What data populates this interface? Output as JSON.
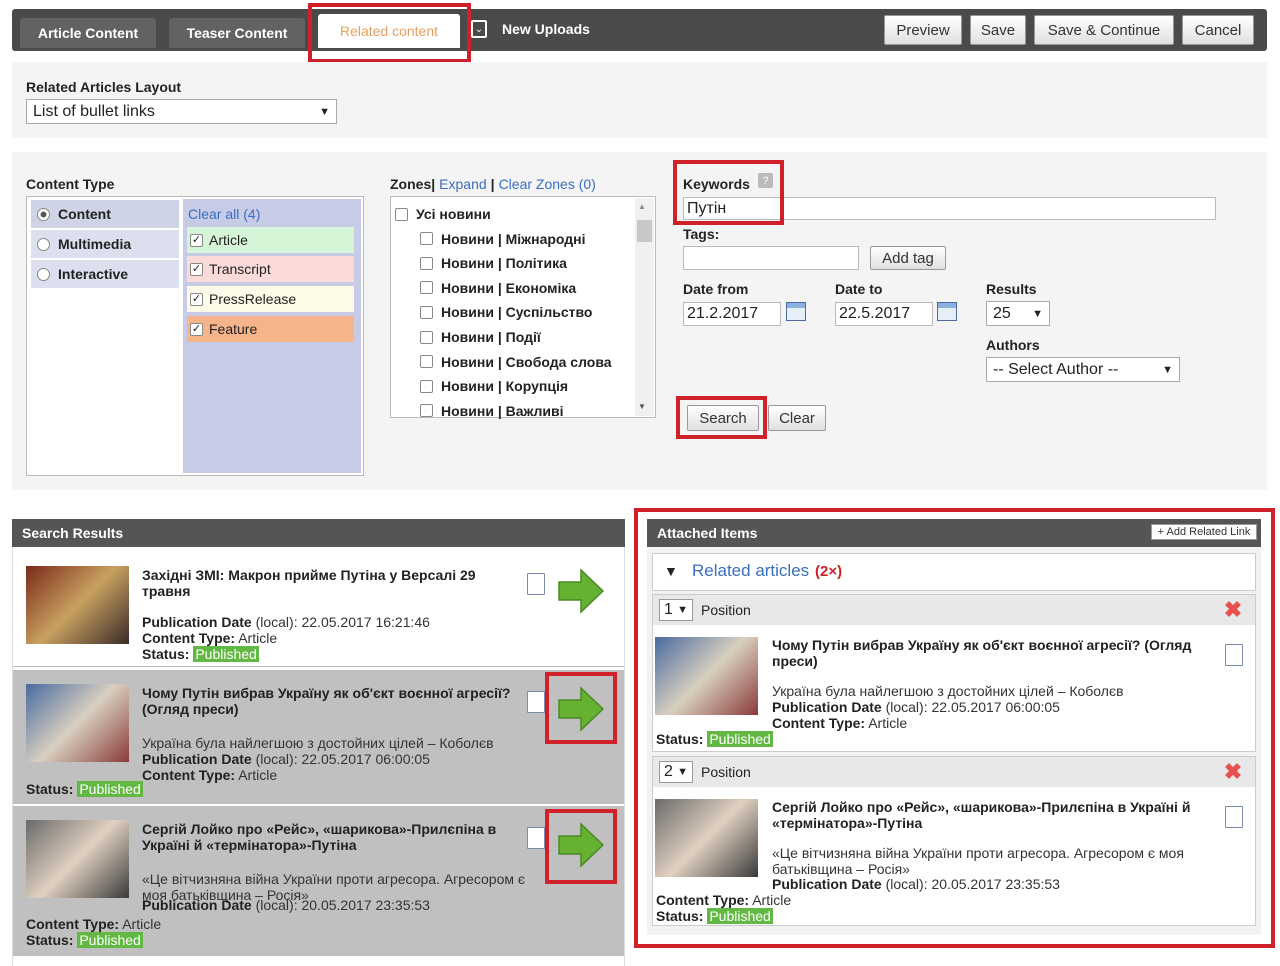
{
  "tabs": {
    "article": "Article Content",
    "teaser": "Teaser Content",
    "related": "Related content",
    "uploads": "New Uploads"
  },
  "toolbar": {
    "preview": "Preview",
    "save": "Save",
    "save_continue": "Save & Continue",
    "cancel": "Cancel"
  },
  "layout": {
    "label": "Related Articles Layout",
    "value": "List of bullet links"
  },
  "content_type": {
    "label": "Content Type",
    "types": [
      "Content",
      "Multimedia",
      "Interactive"
    ],
    "clear_all": "Clear all (4)",
    "subtypes": [
      {
        "label": "Article",
        "color": "#d6f5d6"
      },
      {
        "label": "Transcript",
        "color": "#fbdada"
      },
      {
        "label": "PressRelease",
        "color": "#fdfbe8"
      },
      {
        "label": "Feature",
        "color": "#f6b48a"
      }
    ]
  },
  "zones": {
    "label": "Zones|",
    "expand": "Expand",
    "sep": "|",
    "clear": "Clear Zones (0)",
    "items": [
      "Усі новини",
      "Новини | Міжнародні",
      "Новини | Політика",
      "Новини | Економіка",
      "Новини | Суспільство",
      "Новини | Події",
      "Новини | Свобода слова",
      "Новини | Корупція",
      "Новини | Важливі"
    ]
  },
  "filters": {
    "keywords_label": "Keywords",
    "keywords_value": "Путін",
    "tags_label": "Tags:",
    "add_tag": "Add tag",
    "date_from_label": "Date from",
    "date_from": "21.2.2017",
    "date_to_label": "Date to",
    "date_to": "22.5.2017",
    "results_label": "Results",
    "results_value": "25",
    "authors_label": "Authors",
    "authors_value": "-- Select Author --",
    "search": "Search",
    "clear": "Clear"
  },
  "search_results": {
    "header": "Search Results",
    "items": [
      {
        "title": "Західні ЗМІ: Макрон прийме Путіна у Версалі 29 травня",
        "summary": "",
        "pub_label": "Publication Date",
        "pub_local": "(local):",
        "pub_value": "22.05.2017 16:21:46",
        "type_label": "Content Type:",
        "type_value": "Article",
        "status_label": "Status:",
        "status_value": "Published"
      },
      {
        "title": "Чому Путін вибрав Україну як об'єкт воєнної агресії? (Огляд преси)",
        "summary": "Україна була найлегшою з достойних цілей – Коболєв",
        "pub_label": "Publication Date",
        "pub_local": "(local):",
        "pub_value": "22.05.2017 06:00:05",
        "type_label": "Content Type:",
        "type_value": "Article",
        "status_label": "Status:",
        "status_value": "Published"
      },
      {
        "title": "Сергій Лойко про «Рейс», «шарикова»-Прилєпіна в Україні й «термінатора»-Путіна",
        "summary": "«Це вітчизняна війна України проти агресора. Агресором є моя батьківщина – Росія»",
        "pub_label": "Publication Date",
        "pub_local": "(local):",
        "pub_value": "20.05.2017 23:35:53",
        "type_label": "Content Type:",
        "type_value": "Article",
        "status_label": "Status:",
        "status_value": "Published"
      }
    ]
  },
  "attached": {
    "header": "Attached Items",
    "add_link": "+ Add Related Link",
    "group_label": "Related articles",
    "group_count": "(2×)",
    "position_label": "Position",
    "items": [
      {
        "position": "1",
        "title": "Чому Путін вибрав Україну як об'єкт воєнної агресії? (Огляд преси)",
        "summary": "Україна була найлегшою з достойних цілей – Коболєв",
        "pub_label": "Publication Date",
        "pub_local": "(local):",
        "pub_value": "22.05.2017 06:00:05",
        "type_label": "Content Type:",
        "type_value": "Article",
        "status_label": "Status:",
        "status_value": "Published"
      },
      {
        "position": "2",
        "title": "Сергій Лойко про «Рейс», «шарикова»-Прилєпіна в Україні й «термінатора»-Путіна",
        "summary": "«Це вітчизняна війна України проти агресора. Агресором є моя батьківщина – Росія»",
        "pub_label": "Publication Date",
        "pub_local": "(local):",
        "pub_value": "20.05.2017 23:35:53",
        "type_label": "Content Type:",
        "type_value": "Article",
        "status_label": "Status:",
        "status_value": "Published"
      }
    ]
  },
  "colors": {
    "highlight": "#d0202a",
    "accent_tab": "#e8a060",
    "link": "#3a6ec0",
    "published": "#62b842",
    "arrow": "#66b032"
  }
}
